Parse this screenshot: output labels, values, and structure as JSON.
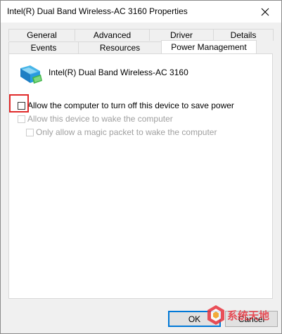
{
  "window": {
    "title": "Intel(R) Dual Band Wireless-AC 3160 Properties"
  },
  "tabs": {
    "row1": [
      "General",
      "Advanced",
      "Driver",
      "Details"
    ],
    "row2": [
      "Events",
      "Resources",
      "Power Management"
    ],
    "active": "Power Management"
  },
  "device": {
    "name": "Intel(R) Dual Band Wireless-AC 3160",
    "icon": "network-adapter-icon"
  },
  "options": {
    "allow_turn_off": {
      "label": "Allow the computer to turn off this device to save power",
      "checked": false,
      "enabled": true
    },
    "allow_wake": {
      "label": "Allow this device to wake the computer",
      "checked": false,
      "enabled": false
    },
    "magic_packet": {
      "label": "Only allow a magic packet to wake the computer",
      "checked": false,
      "enabled": false
    }
  },
  "buttons": {
    "ok": "OK",
    "cancel": "Cancel"
  },
  "watermark": {
    "text": "系统天地"
  },
  "colors": {
    "highlight": "#e02a2a",
    "accent": "#0078d7",
    "watermark": "#e8343e"
  }
}
